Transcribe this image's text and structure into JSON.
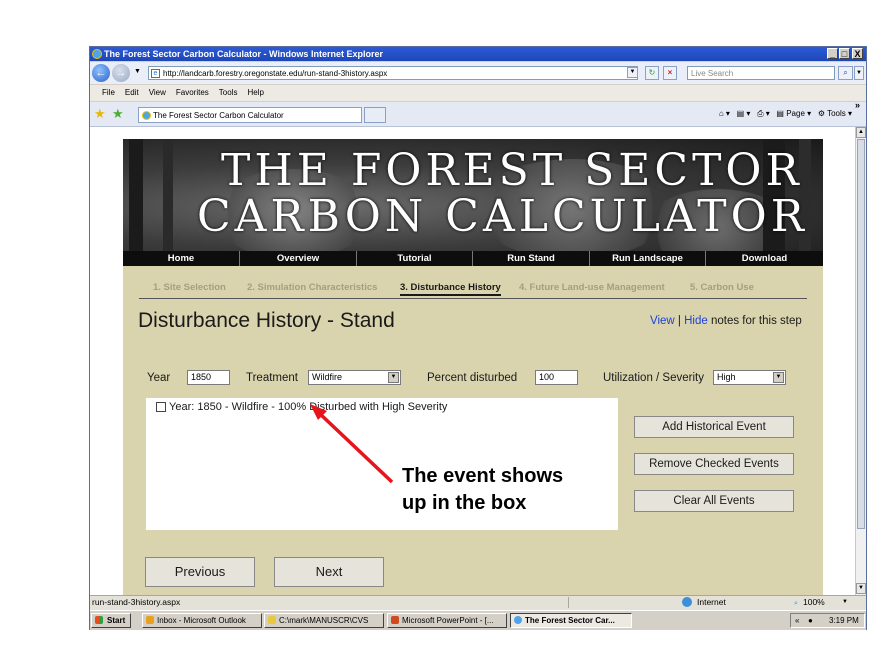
{
  "window": {
    "title": "The Forest Sector Carbon Calculator - Windows Internet Explorer",
    "controls": [
      "_",
      "□",
      "X"
    ]
  },
  "address": {
    "url": "http://landcarb.forestry.oregonstate.edu/run-stand-3history.aspx",
    "search_placeholder": "Live Search"
  },
  "menu": [
    "File",
    "Edit",
    "View",
    "Favorites",
    "Tools",
    "Help"
  ],
  "tab": {
    "label": "The Forest Sector Carbon Calculator"
  },
  "command_bar": {
    "page": "Page",
    "tools": "Tools"
  },
  "site": {
    "banner_line1": "THE FOREST SECTOR",
    "banner_line2": "CARBON CALCULATOR",
    "nav": [
      "Home",
      "Overview",
      "Tutorial",
      "Run Stand",
      "Run Landscape",
      "Download"
    ],
    "steps": [
      "1. Site Selection",
      "2. Simulation Characteristics",
      "3. Disturbance History",
      "4. Future Land-use Management",
      "5. Carbon Use"
    ],
    "active_step_index": 2,
    "page_title": "Disturbance History - Stand",
    "notes_view": "View",
    "notes_sep": "|",
    "notes_hide": "Hide",
    "notes_suffix": "notes for this step"
  },
  "form": {
    "year_label": "Year",
    "year_value": "1850",
    "treatment_label": "Treatment",
    "treatment_value": "Wildfire",
    "percent_label": "Percent disturbed",
    "percent_value": "100",
    "severity_label": "Utilization / Severity",
    "severity_value": "High"
  },
  "events": [
    "Year: 1850 - Wildfire - 100% Disturbed with High Severity"
  ],
  "buttons": {
    "add": "Add Historical Event",
    "remove": "Remove Checked Events",
    "clear": "Clear All Events",
    "previous": "Previous",
    "next": "Next"
  },
  "annotation": {
    "line1": "The event shows",
    "line2": "up in the box",
    "arrow_color": "#e8141b"
  },
  "status": {
    "url": "run-stand-3history.aspx",
    "zone": "Internet",
    "zoom": "100%"
  },
  "taskbar": {
    "start": "Start",
    "items": [
      "Inbox - Microsoft Outlook",
      "C:\\mark\\MANUSCR\\CVS",
      "Microsoft PowerPoint - [...",
      "The Forest Sector Car..."
    ],
    "clock": "3:19 PM"
  }
}
